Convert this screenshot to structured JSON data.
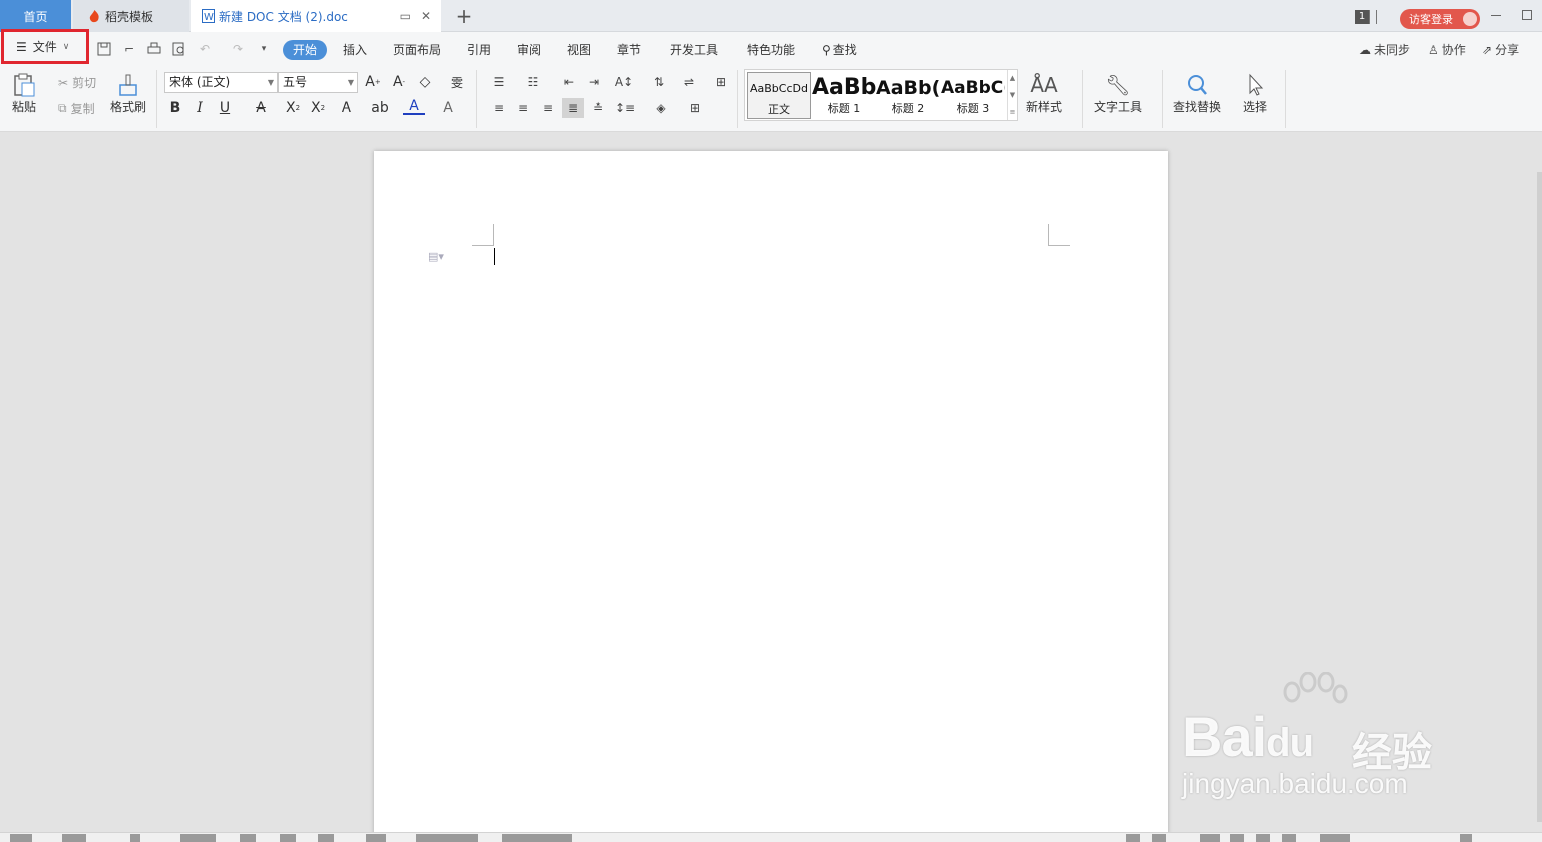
{
  "tabs": {
    "home": "首页",
    "template": "稻壳模板",
    "document": "新建 DOC 文档 (2).doc",
    "new_tab": "+"
  },
  "title_right": {
    "page_count": "1",
    "login": "访客登录"
  },
  "menu": {
    "file": "文件",
    "items": [
      "开始",
      "插入",
      "页面布局",
      "引用",
      "审阅",
      "视图",
      "章节",
      "开发工具",
      "特色功能"
    ],
    "search": "查找",
    "right": {
      "sync": "未同步",
      "collab": "协作",
      "share": "分享"
    }
  },
  "ribbon": {
    "paste": "粘贴",
    "cut": "剪切",
    "copy": "复制",
    "format_painter": "格式刷",
    "font_name": "宋体 (正文)",
    "font_size": "五号",
    "bold": "B",
    "italic": "I",
    "underline": "U",
    "styles": [
      {
        "preview": "AaBbCcDd",
        "label": "正文"
      },
      {
        "preview": "AaBb",
        "label": "标题 1"
      },
      {
        "preview": "AaBb(",
        "label": "标题 2"
      },
      {
        "preview": "AaBbC(",
        "label": "标题 3"
      }
    ],
    "new_style": "新样式",
    "text_tools": "文字工具",
    "find_replace": "查找替换",
    "select": "选择"
  },
  "watermark": {
    "logo": "Bai",
    "logo_tail": "du",
    "jingyan": "经验",
    "url": "jingyan.baidu.com"
  },
  "colors": {
    "accent": "#4b8fd8",
    "highlight_box": "#e0262f",
    "login": "#e2574c"
  }
}
